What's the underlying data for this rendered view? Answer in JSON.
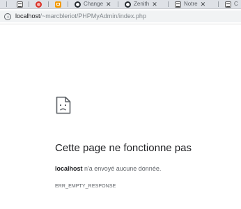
{
  "tabs": [
    {
      "icon": "phpmyadmin-icon",
      "title": ""
    },
    {
      "icon": "red-circle-icon",
      "title": ""
    },
    {
      "icon": "orange-box-icon",
      "title": ""
    },
    {
      "icon": "github-icon",
      "title": "Change"
    },
    {
      "icon": "github-icon",
      "title": "Zenith"
    },
    {
      "icon": "phpmyadmin-icon",
      "title": "Notre"
    },
    {
      "icon": "phpmyadmin-icon",
      "title": "C"
    }
  ],
  "address_bar": {
    "host": "localhost",
    "path": "/~marcbleriot/PHPMyAdmin/index.php"
  },
  "error_page": {
    "icon": "sad-page-icon",
    "title": "Cette page ne fonctionne pas",
    "host": "localhost",
    "message": " n'a envoyé aucune donnée.",
    "code": "ERR_EMPTY_RESPONSE"
  }
}
